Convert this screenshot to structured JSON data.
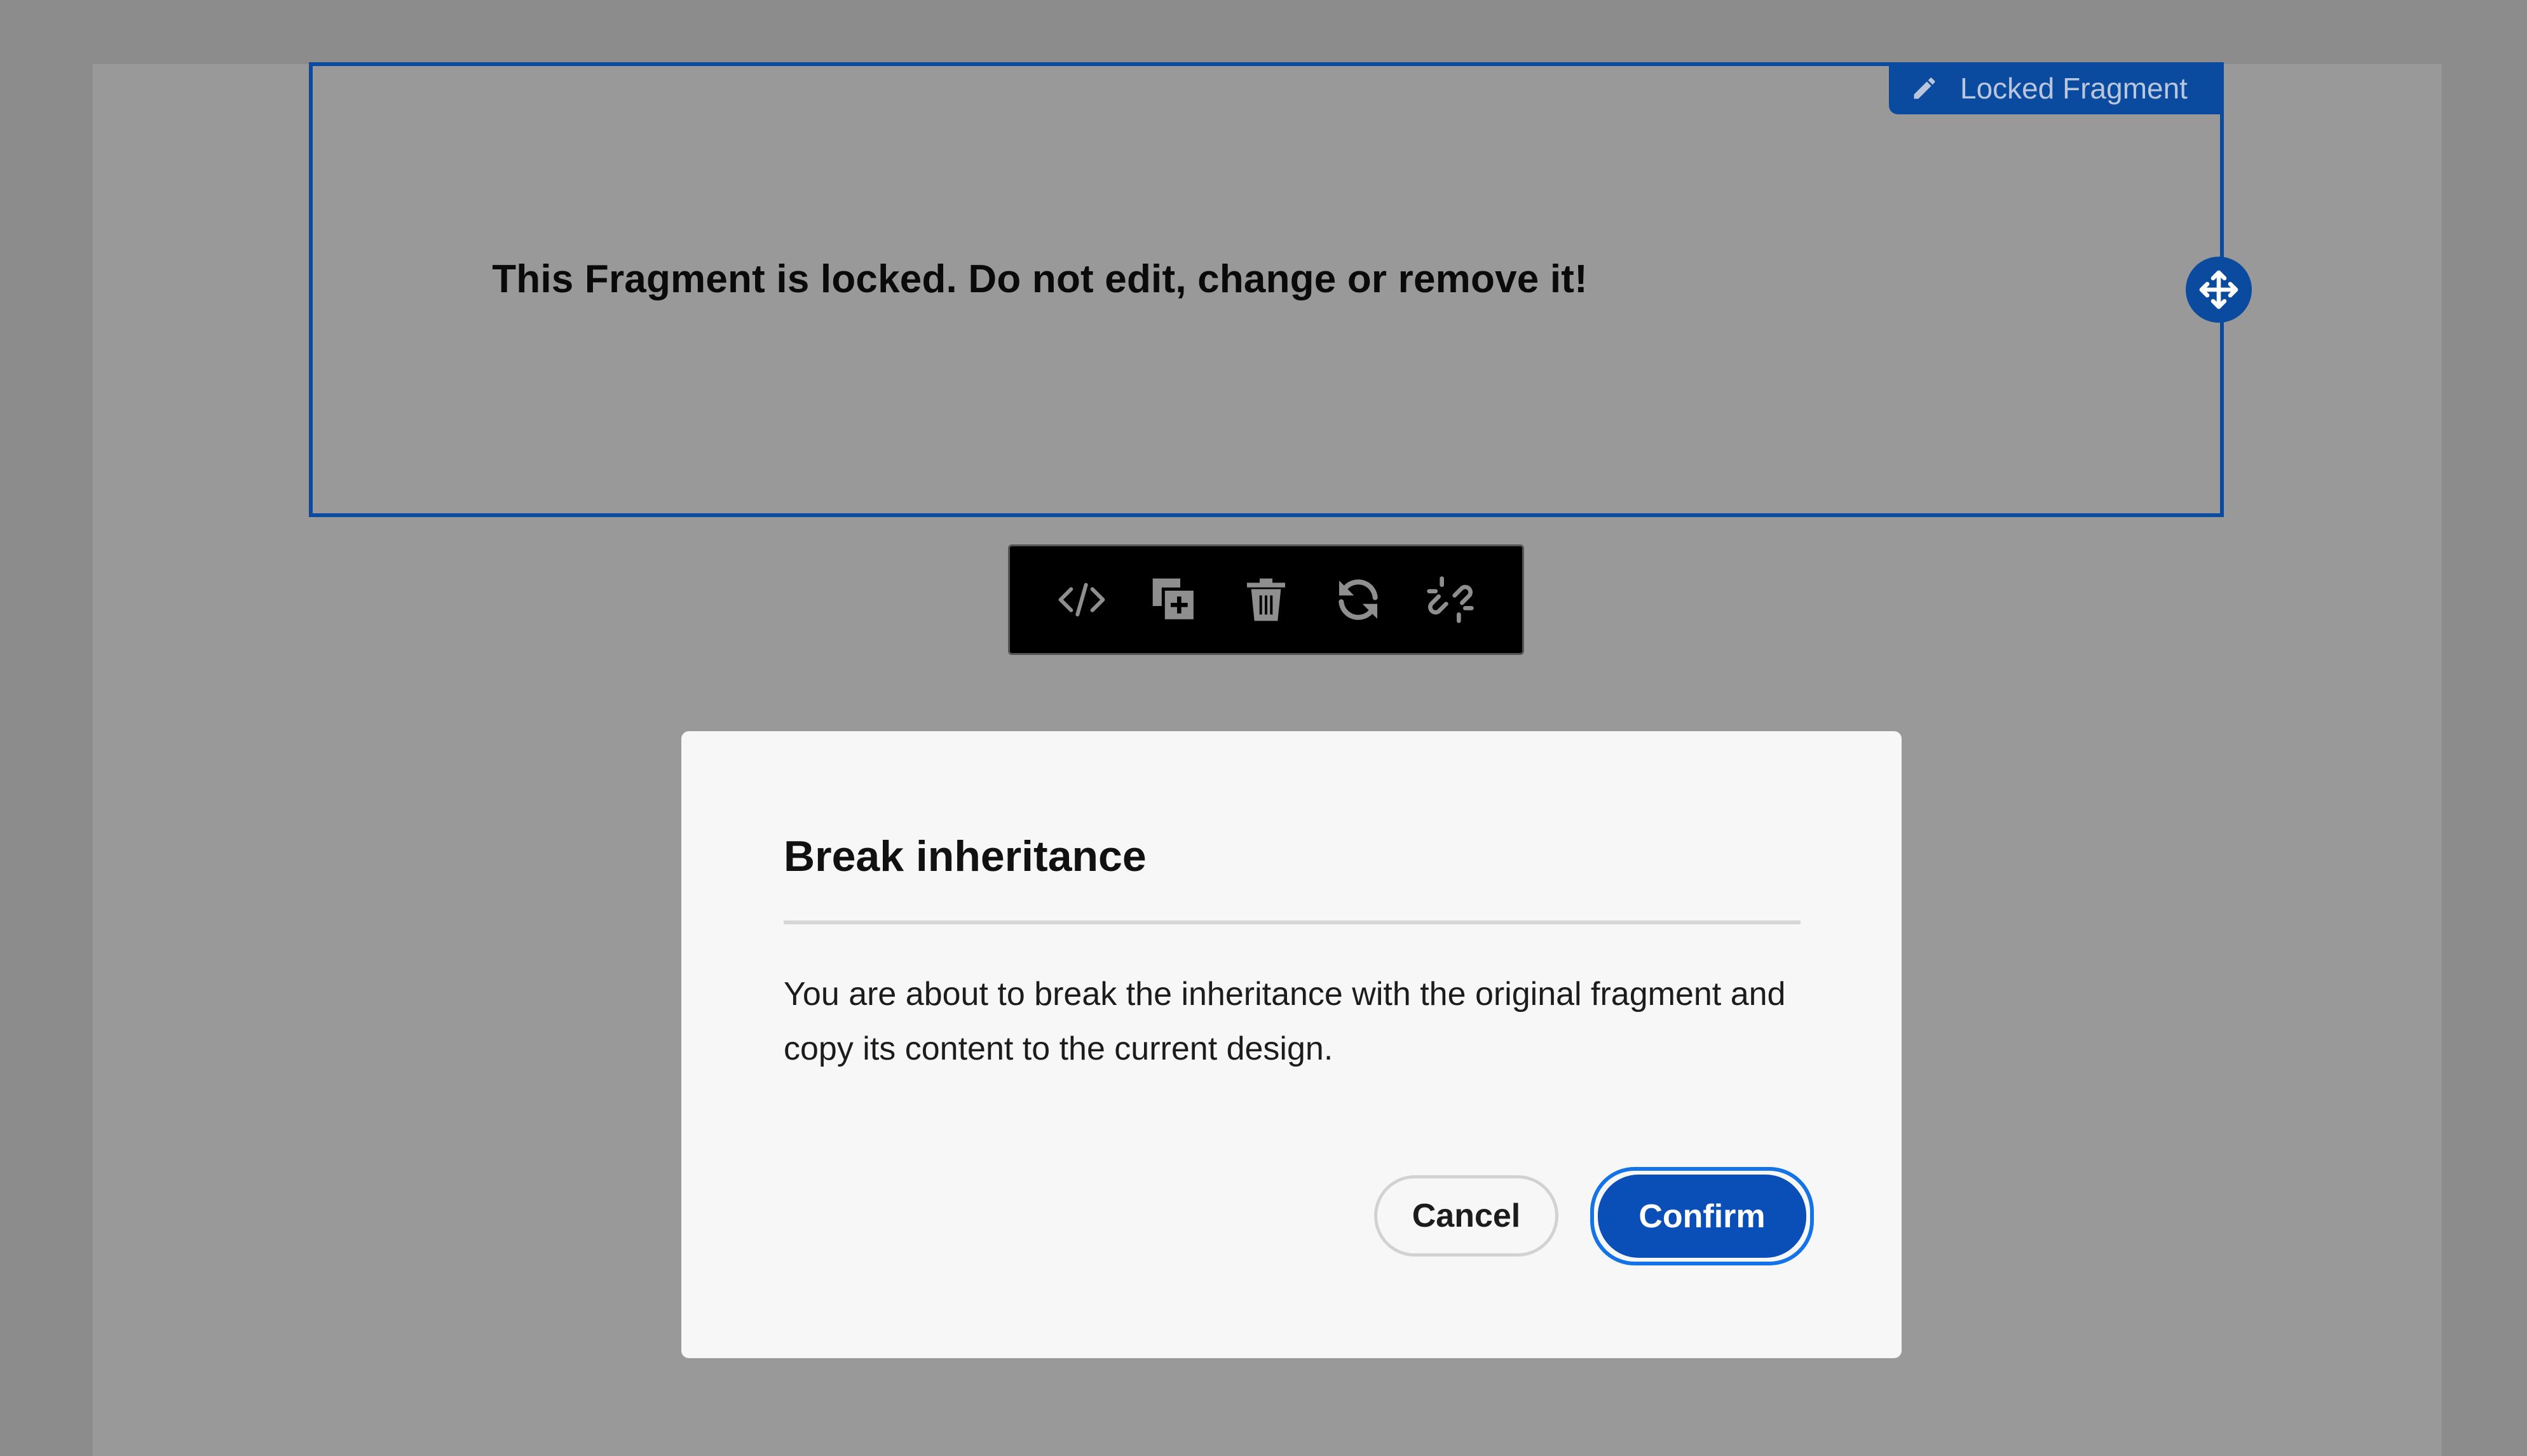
{
  "fragment": {
    "tag_label": "Locked Fragment",
    "tag_icon": "pencil-icon",
    "message": "This Fragment is locked. Do not edit, change or remove it!",
    "move_icon": "move-icon"
  },
  "toolbar": {
    "buttons": [
      {
        "icon": "code-icon",
        "name": "edit-code"
      },
      {
        "icon": "duplicate-icon",
        "name": "duplicate"
      },
      {
        "icon": "trash-icon",
        "name": "delete"
      },
      {
        "icon": "refresh-icon",
        "name": "refresh"
      },
      {
        "icon": "unlink-icon",
        "name": "break-link"
      }
    ]
  },
  "dialog": {
    "title": "Break inheritance",
    "body": "You are about to break the inheritance with the original fragment and copy its content to the current design.",
    "cancel_label": "Cancel",
    "confirm_label": "Confirm"
  },
  "colors": {
    "overlay": "#8c8c8c",
    "accent": "#0a4a9f",
    "confirm": "#0a4fb8",
    "focus_ring": "#1473e6",
    "toolbar_bg": "#000000",
    "dialog_bg": "#f7f7f7"
  }
}
